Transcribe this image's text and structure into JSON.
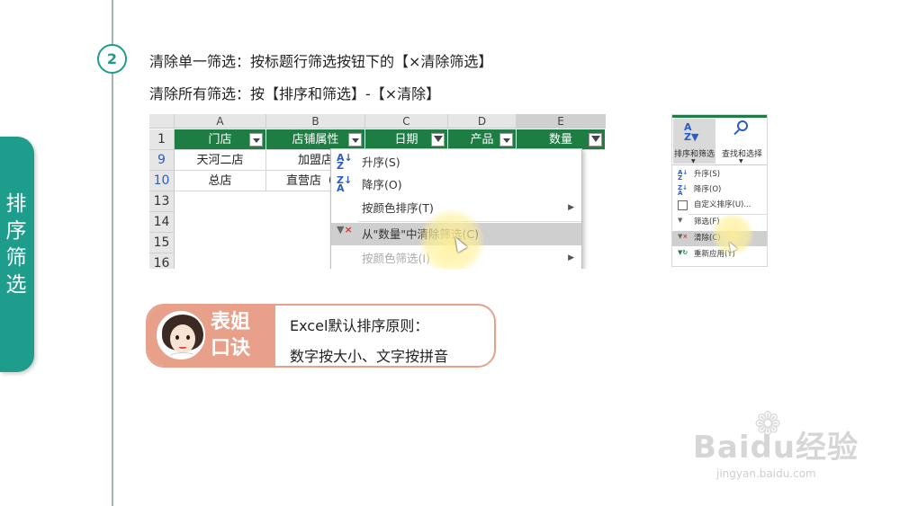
{
  "side_tab": {
    "chars": [
      "排",
      "序",
      "筛",
      "选"
    ]
  },
  "step": {
    "number": "2",
    "line1": "清除单一筛选：按标题行筛选按钮下的【×清除筛选】",
    "line2": "清除所有筛选：按【排序和筛选】-【×清除】"
  },
  "spreadsheet": {
    "columns": [
      "A",
      "B",
      "C",
      "D",
      "E"
    ],
    "rows": [
      "1",
      "9",
      "10",
      "13",
      "14",
      "15",
      "16"
    ],
    "headers": [
      "门店",
      "店铺属性",
      "日期",
      "产品",
      "数量"
    ],
    "row9": [
      "天河二店",
      "加盟店"
    ],
    "row10": [
      "总店",
      "直营店（旗"
    ]
  },
  "context_menu": {
    "items": [
      {
        "icon": "sort-ascending-icon",
        "label": "升序(S)"
      },
      {
        "icon": "sort-descending-icon",
        "label": "降序(O)"
      },
      {
        "icon": "",
        "label": "按颜色排序(T)"
      },
      {
        "icon": "clear-filter-icon",
        "label": "从\"数量\"中清除筛选(C)"
      },
      {
        "icon": "",
        "label": "按颜色筛选(I)"
      }
    ]
  },
  "ribbon": {
    "sort_filter_label": "排序和筛选",
    "find_select_label": "查找和选择",
    "items": [
      {
        "icon": "sort-ascending-icon",
        "label": "升序(S)"
      },
      {
        "icon": "sort-descending-icon",
        "label": "降序(O)"
      },
      {
        "icon": "custom-sort-icon",
        "label": "自定义排序(U)..."
      },
      {
        "icon": "filter-icon",
        "label": "筛选(F)"
      },
      {
        "icon": "clear-icon",
        "label": "清除(C)"
      },
      {
        "icon": "reapply-icon",
        "label": "重新应用(Y)"
      }
    ]
  },
  "tip": {
    "title_line1": "表姐",
    "title_line2": "口诀",
    "text1": "Excel默认排序原则：",
    "text2": "数字按大小、文字按拼音"
  },
  "watermark": {
    "brand": "Baidu经验",
    "url": "jingyan.baidu.com"
  },
  "colors": {
    "accent": "#1e9c8c",
    "header_green": "#1e7d43",
    "tip_salmon": "#e8a08a"
  }
}
